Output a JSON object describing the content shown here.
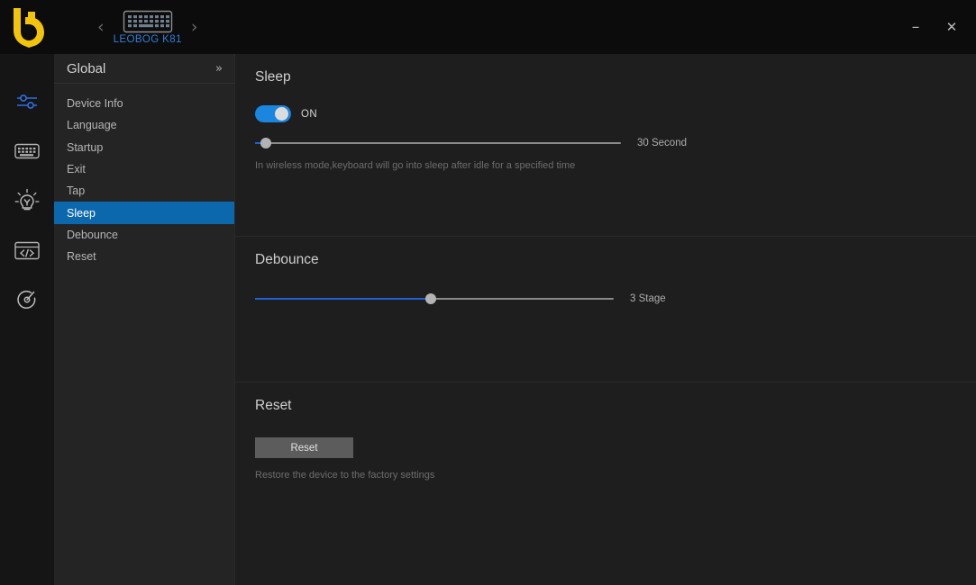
{
  "titlebar": {
    "logo_name": "leobog-logo",
    "device": {
      "name": "LEOBOG K81",
      "prev_arrow": "‹",
      "next_arrow": "›",
      "icon": "keyboard-icon"
    },
    "window_controls": {
      "minimize": "–",
      "close": "✕"
    }
  },
  "rail": {
    "items": [
      {
        "icon": "sliders-icon",
        "active": true
      },
      {
        "icon": "keyboard-icon",
        "active": false
      },
      {
        "icon": "lightbulb-icon",
        "active": false
      },
      {
        "icon": "code-icon",
        "active": false
      },
      {
        "icon": "gauge-icon",
        "active": false
      }
    ]
  },
  "menu": {
    "title": "Global",
    "collapse_icon": "»",
    "items": [
      {
        "label": "Device Info"
      },
      {
        "label": "Language"
      },
      {
        "label": "Startup"
      },
      {
        "label": "Exit"
      },
      {
        "label": "Tap"
      },
      {
        "label": "Sleep"
      },
      {
        "label": "Debounce"
      },
      {
        "label": "Reset"
      }
    ],
    "active_index": 5
  },
  "content": {
    "sleep": {
      "title": "Sleep",
      "toggle_state": "ON",
      "toggle_on": true,
      "slider_value": "30 Second",
      "slider_percent": 3,
      "hint": "In wireless mode,keyboard will go into sleep after idle for a specified time"
    },
    "debounce": {
      "title": "Debounce",
      "slider_value": "3 Stage",
      "slider_percent": 49
    },
    "reset": {
      "title": "Reset",
      "button_label": "Reset",
      "hint": "Restore the device to the factory settings"
    }
  },
  "colors": {
    "accent_blue": "#0b68ad",
    "toggle_blue": "#1a86e0",
    "slider_blue": "#1f62d8",
    "logo_yellow": "#f2c40c",
    "device_blue": "#2f7fd6"
  }
}
